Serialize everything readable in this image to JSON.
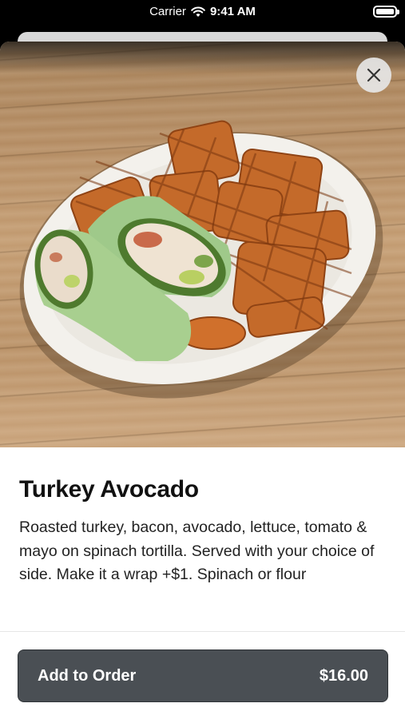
{
  "status_bar": {
    "carrier": "Carrier",
    "time": "9:41 AM"
  },
  "item": {
    "title": "Turkey Avocado",
    "description": "Roasted turkey, bacon, avocado, lettuce, tomato & mayo on spinach tortilla. Served with your choice of side. Make it a wrap +$1. Spinach or flour",
    "image_icon": "food-photo-turkey-avocado-wrap-waffle-fries"
  },
  "actions": {
    "close_icon": "close-icon",
    "add_label": "Add to Order",
    "price": "$16.00"
  },
  "colors": {
    "button_bg": "#4a4f54",
    "text": "#111111",
    "close_bg": "#e6e6e6"
  }
}
